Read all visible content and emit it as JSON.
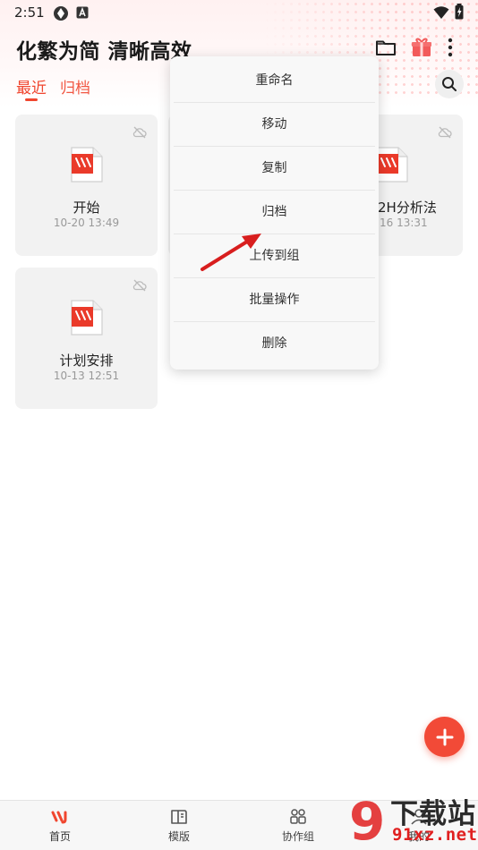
{
  "status_bar": {
    "time": "2:51"
  },
  "header": {
    "title": "化繁为简 清晰高效"
  },
  "tabs": [
    {
      "label": "最近",
      "active": true
    },
    {
      "label": "归档",
      "active": false
    }
  ],
  "cards": [
    {
      "title": "开始",
      "date": "10-20 13:49"
    },
    {
      "title": "2H分析法",
      "date": "16 13:31"
    },
    {
      "title": "计划安排",
      "date": "10-13 12:51"
    }
  ],
  "context_menu": {
    "items": [
      "重命名",
      "移动",
      "复制",
      "归档",
      "上传到组",
      "批量操作",
      "删除"
    ]
  },
  "bottom_nav": [
    {
      "label": "首页",
      "icon": "home-logo-icon",
      "active": true
    },
    {
      "label": "模版",
      "icon": "template-book-icon",
      "active": false
    },
    {
      "label": "协作组",
      "icon": "team-icon",
      "active": false
    },
    {
      "label": "我的",
      "icon": "profile-icon",
      "active": false
    }
  ],
  "watermark": {
    "brand": "下载站",
    "url": "91xz.net",
    "number": "9"
  },
  "colors": {
    "accent": "#f0462f",
    "card_bg": "#f2f2f2",
    "menu_bg": "#f8f8f8",
    "arrow": "#d81e1e"
  }
}
